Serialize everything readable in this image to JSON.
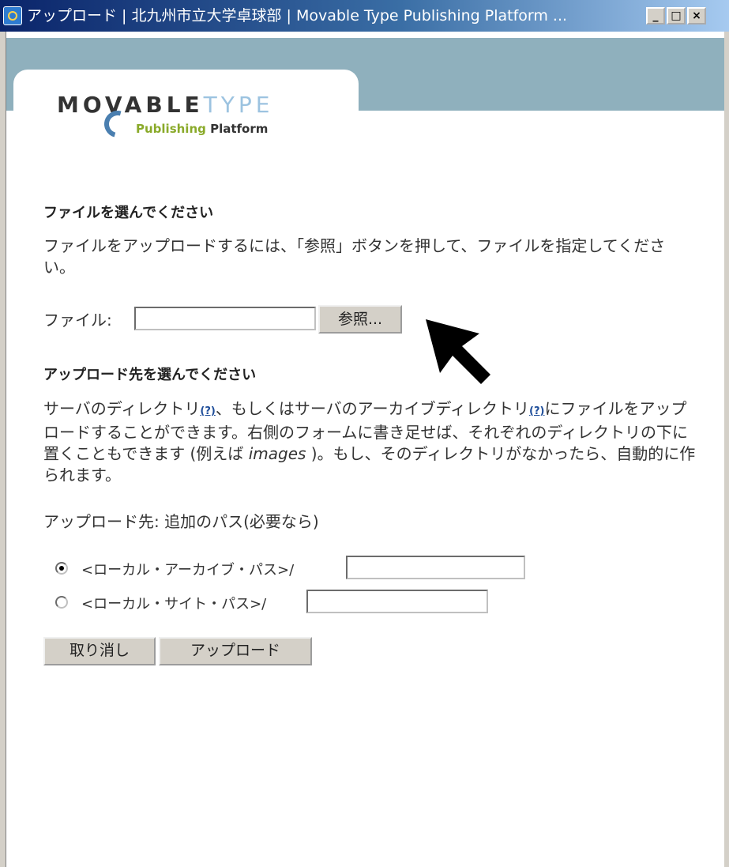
{
  "window": {
    "title": "アップロード | 北九州市立大学卓球部 | Movable Type Publishing Platform ...",
    "minimize": "_",
    "maximize": "□",
    "close": "×"
  },
  "logo": {
    "line1_a": "MOVABLE",
    "line1_b": "TYPE",
    "line2_a": "Publishing",
    "line2_b": "Platform"
  },
  "file_section": {
    "heading": "ファイルを選んでください",
    "description": "ファイルをアップロードするには、「参照」ボタンを押して、ファイルを指定してください。",
    "file_label": "ファイル:",
    "file_value": "",
    "browse_label": "参照..."
  },
  "destination_section": {
    "heading": "アップロード先を選んでください",
    "desc_part1": "サーバのディレクトリ",
    "help1": "(?)",
    "desc_part2": "、もしくはサーバのアーカイブディレクトリ",
    "help2": "(?)",
    "desc_part3": "にファイルをアップロードすることができます。右側のフォームに書き足せば、それぞれのディレクトリの下に置くこともできます (例えば ",
    "desc_example": "images",
    "desc_part4": " )。もし、そのディレクトリがなかったら、自動的に作られます。",
    "upload_to_label": "アップロード先: 追加のパス(必要なら)",
    "options": [
      {
        "label": "<ローカル・アーカイブ・パス>/",
        "checked": true,
        "value": ""
      },
      {
        "label": "<ローカル・サイト・パス>/",
        "checked": false,
        "value": ""
      }
    ]
  },
  "actions": {
    "cancel_label": "取り消し",
    "upload_label": "アップロード"
  }
}
